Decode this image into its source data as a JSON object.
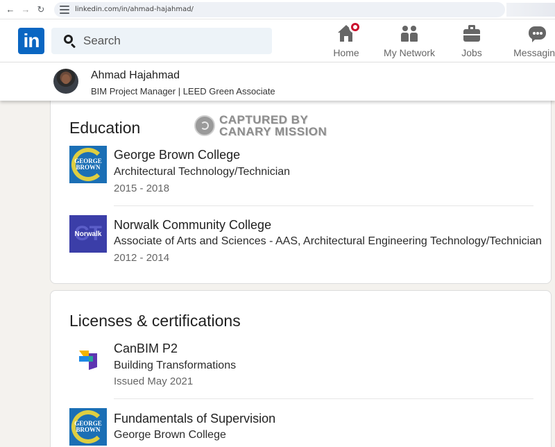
{
  "browser": {
    "url": "linkedin.com/in/ahmad-hajahmad/",
    "back_icon": "arrow-left-icon",
    "forward_icon": "arrow-right-icon",
    "reload_icon": "reload-icon"
  },
  "topnav": {
    "logo_text": "in",
    "search_placeholder": "Search",
    "items": [
      {
        "label": "Home",
        "icon": "home-icon"
      },
      {
        "label": "My Network",
        "icon": "people-icon"
      },
      {
        "label": "Jobs",
        "icon": "briefcase-icon"
      },
      {
        "label": "Messaging",
        "icon": "chat-icon"
      }
    ]
  },
  "profile": {
    "name": "Ahmad Hajahmad",
    "headline": "BIM Project Manager | LEED Green Associate"
  },
  "watermark": {
    "line1": "CAPTURED BY",
    "line2": "CANARY MISSION"
  },
  "education": {
    "title": "Education",
    "entries": [
      {
        "school": "George Brown College",
        "program": "Architectural Technology/Technician",
        "dates": "2015 - 2018",
        "logo_text": "GEORGE BROWN"
      },
      {
        "school": "Norwalk Community College",
        "program": "Associate of Arts and Sciences - AAS, Architectural Engineering Technology/Technician",
        "dates": "2012 - 2014",
        "logo_text": "Norwalk"
      }
    ]
  },
  "licenses": {
    "title": "Licenses & certifications",
    "entries": [
      {
        "name": "CanBIM P2",
        "issuer": "Building Transformations",
        "issued": "Issued May 2021"
      },
      {
        "name": "Fundamentals of Supervision",
        "issuer": "George Brown College",
        "logo_text": "GEORGE BROWN"
      }
    ]
  },
  "colors": {
    "brand": "#0a66c2",
    "notification": "#cb112d",
    "page_bg": "#f4f2ee"
  }
}
